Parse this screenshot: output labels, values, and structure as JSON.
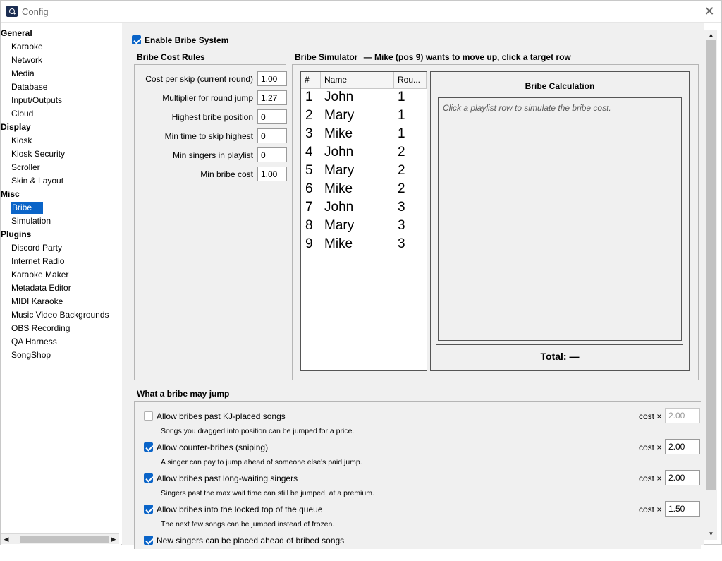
{
  "window": {
    "title": "Config"
  },
  "sidebar": {
    "tree": [
      {
        "type": "cat",
        "label": "General"
      },
      {
        "type": "item",
        "label": "Karaoke"
      },
      {
        "type": "item",
        "label": "Network"
      },
      {
        "type": "item",
        "label": "Media"
      },
      {
        "type": "item",
        "label": "Database"
      },
      {
        "type": "item",
        "label": "Input/Outputs"
      },
      {
        "type": "item",
        "label": "Cloud"
      },
      {
        "type": "cat",
        "label": "Display"
      },
      {
        "type": "item",
        "label": "Kiosk"
      },
      {
        "type": "item",
        "label": "Kiosk Security"
      },
      {
        "type": "item",
        "label": "Scroller"
      },
      {
        "type": "item",
        "label": "Skin & Layout"
      },
      {
        "type": "cat",
        "label": "Misc"
      },
      {
        "type": "item",
        "label": "Bribe",
        "selected": true
      },
      {
        "type": "item",
        "label": "Simulation"
      },
      {
        "type": "cat",
        "label": "Plugins"
      },
      {
        "type": "item",
        "label": "Discord Party"
      },
      {
        "type": "item",
        "label": "Internet Radio"
      },
      {
        "type": "item",
        "label": "Karaoke Maker"
      },
      {
        "type": "item",
        "label": "Metadata Editor"
      },
      {
        "type": "item",
        "label": "MIDI Karaoke"
      },
      {
        "type": "item",
        "label": "Music Video Backgrounds"
      },
      {
        "type": "item",
        "label": "OBS Recording"
      },
      {
        "type": "item",
        "label": "QA Harness"
      },
      {
        "type": "item",
        "label": "SongShop"
      }
    ]
  },
  "main": {
    "enable_label": "Enable Bribe System",
    "enable_checked": true,
    "cost_rules": {
      "title": "Bribe Cost Rules",
      "rules": [
        {
          "label": "Cost per skip (current round)",
          "value": "1.00"
        },
        {
          "label": "Multiplier for round jump",
          "value": "1.27"
        },
        {
          "label": "Highest bribe position",
          "value": "0"
        },
        {
          "label": "Min time to skip highest",
          "value": "0"
        },
        {
          "label": "Min singers in playlist",
          "value": "0"
        },
        {
          "label": "Min bribe cost",
          "value": "1.00"
        }
      ]
    },
    "simulator": {
      "title": "Bribe Simulator",
      "subtitle": "— Mike (pos 9) wants to move up, click a target row",
      "columns": [
        "#",
        "Name",
        "Rou..."
      ],
      "rows": [
        {
          "pos": "1",
          "name": "John",
          "round": "1"
        },
        {
          "pos": "2",
          "name": "Mary",
          "round": "1"
        },
        {
          "pos": "3",
          "name": "Mike",
          "round": "1"
        },
        {
          "pos": "4",
          "name": "John",
          "round": "2"
        },
        {
          "pos": "5",
          "name": "Mary",
          "round": "2"
        },
        {
          "pos": "6",
          "name": "Mike",
          "round": "2"
        },
        {
          "pos": "7",
          "name": "John",
          "round": "3"
        },
        {
          "pos": "8",
          "name": "Mary",
          "round": "3"
        },
        {
          "pos": "9",
          "name": "Mike",
          "round": "3"
        }
      ],
      "calc_title": "Bribe Calculation",
      "calc_hint": "Click a playlist row to simulate the bribe cost.",
      "total": "Total: —"
    },
    "jump": {
      "title": "What a bribe may jump",
      "cost_prefix": "cost ×",
      "options": [
        {
          "label": "Allow bribes past KJ-placed songs",
          "desc": "Songs you dragged into position can be jumped for a price.",
          "checked": false,
          "cost": "2.00",
          "enabled": false
        },
        {
          "label": "Allow counter-bribes (sniping)",
          "desc": "A singer can pay to jump ahead of someone else's paid jump.",
          "checked": true,
          "cost": "2.00",
          "enabled": true
        },
        {
          "label": "Allow bribes past long-waiting singers",
          "desc": "Singers past the max wait time can still be jumped, at a premium.",
          "checked": true,
          "cost": "2.00",
          "enabled": true
        },
        {
          "label": "Allow bribes into the locked top of the queue",
          "desc": "The next few songs can be jumped instead of frozen.",
          "checked": true,
          "cost": "1.50",
          "enabled": true
        },
        {
          "label": "New singers can be placed ahead of bribed songs",
          "desc": "",
          "checked": true,
          "cost": "",
          "enabled": true
        }
      ]
    }
  },
  "colors": {
    "accent": "#0a64c8",
    "panel_bg": "#f0f0f0"
  }
}
